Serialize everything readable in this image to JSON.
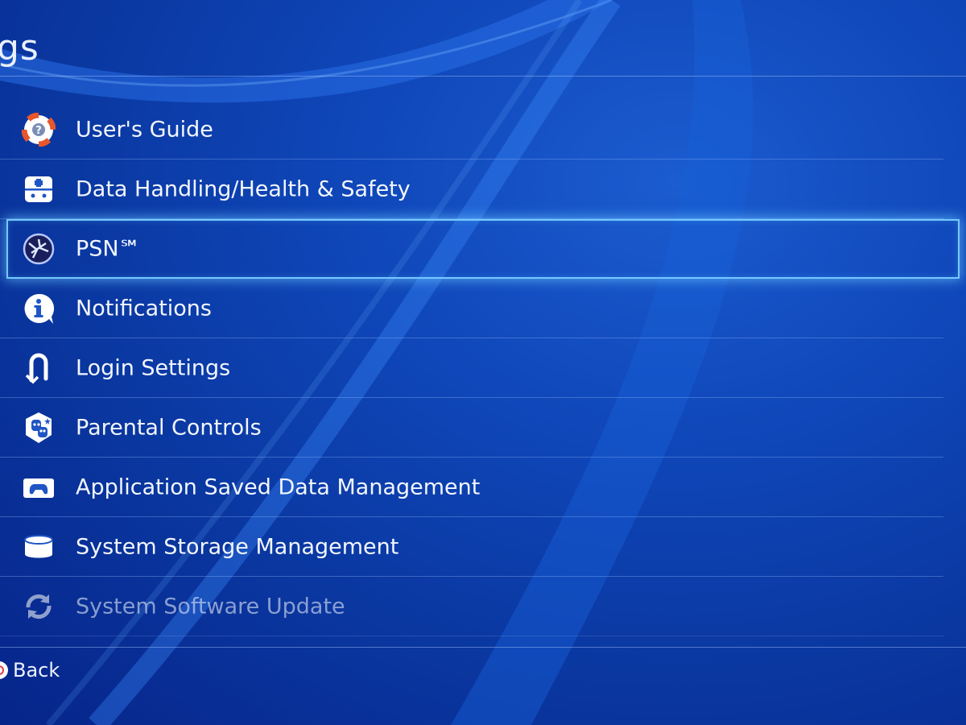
{
  "header": {
    "title": "gs"
  },
  "menu": {
    "items": [
      {
        "label": "User's Guide",
        "icon": "lifebuoy-icon"
      },
      {
        "label": "Data Handling/Health & Safety",
        "icon": "first-aid-icon"
      },
      {
        "label": "PSN℠",
        "icon": "psn-globe-icon",
        "selected": true
      },
      {
        "label": "Notifications",
        "icon": "info-icon"
      },
      {
        "label": "Login Settings",
        "icon": "login-icon"
      },
      {
        "label": "Parental Controls",
        "icon": "parental-controls-icon"
      },
      {
        "label": "Application Saved Data Management",
        "icon": "controller-icon"
      },
      {
        "label": "System Storage Management",
        "icon": "storage-icon"
      },
      {
        "label": "System Software Update",
        "icon": "update-icon"
      }
    ]
  },
  "footer": {
    "back_label": "Back",
    "back_button_icon": "circle-button-icon"
  },
  "colors": {
    "background": "#0f46b8",
    "selection_outline": "#74c8ff",
    "text": "#f2f6ff",
    "circle_button": "#e03a48"
  }
}
